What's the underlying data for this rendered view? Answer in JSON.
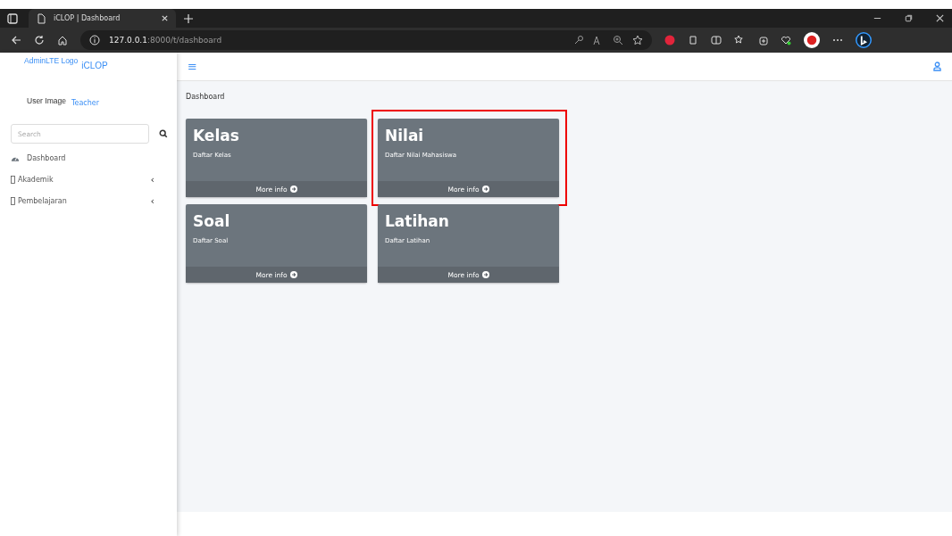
{
  "browser": {
    "tab_title": "iCLOP | Dashboard",
    "url_host": "127.0.0.1",
    "url_rest": ":8000/t/dashboard"
  },
  "sidebar": {
    "logo_alt": "AdminLTE Logo",
    "brand": "iCLOP",
    "user_image_alt": "User Image",
    "user_name": "Teacher",
    "search": {
      "placeholder": "Search"
    },
    "items": [
      {
        "kind": "gauge",
        "label": "Dashboard"
      },
      {
        "kind": "box",
        "label": "Akademik",
        "caret": "‹"
      },
      {
        "kind": "box",
        "label": "Pembelajaran",
        "caret": "‹"
      }
    ]
  },
  "navbar": {
    "menu_glyph": "≡"
  },
  "breadcrumb": "Dashboard",
  "cards": [
    {
      "title": "Kelas",
      "subtitle": "Daftar Kelas",
      "link": "More info",
      "highlighted": false
    },
    {
      "title": "Nilai",
      "subtitle": "Daftar Nilai Mahasiswa",
      "link": "More info",
      "highlighted": true
    },
    {
      "title": "Soal",
      "subtitle": "Daftar Soal",
      "link": "More info",
      "highlighted": false
    },
    {
      "title": "Latihan",
      "subtitle": "Daftar Latihan",
      "link": "More info",
      "highlighted": false
    }
  ]
}
